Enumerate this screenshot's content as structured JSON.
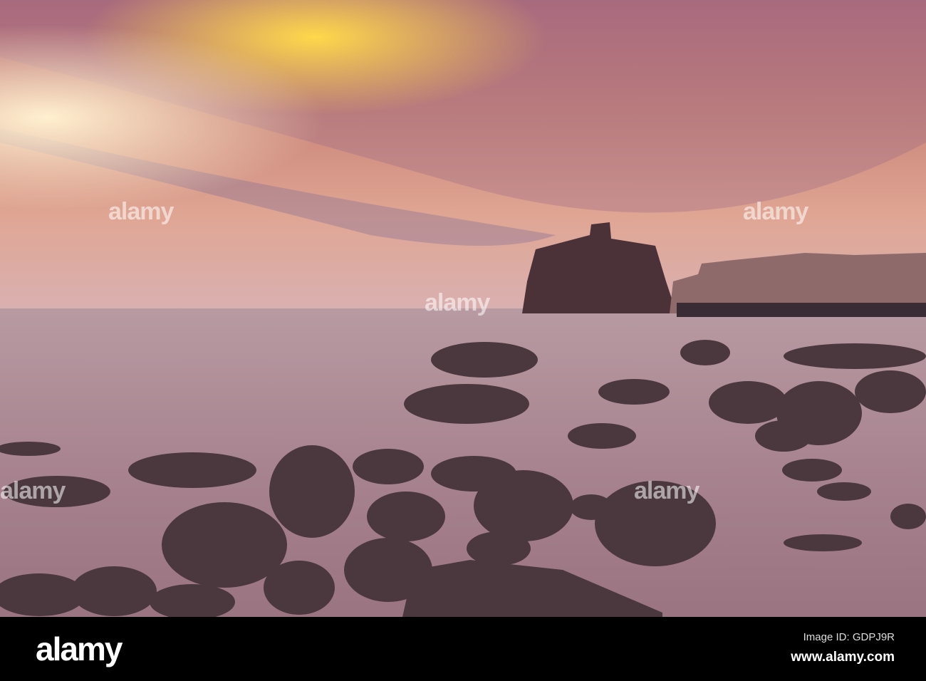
{
  "photo": {
    "subject": "Aci Castello at sunset with lava rocks",
    "watermark": "alamy"
  },
  "footer": {
    "logo": "alamy",
    "image_id": "Image ID: GDPJ9R",
    "website": "www.alamy.com"
  }
}
